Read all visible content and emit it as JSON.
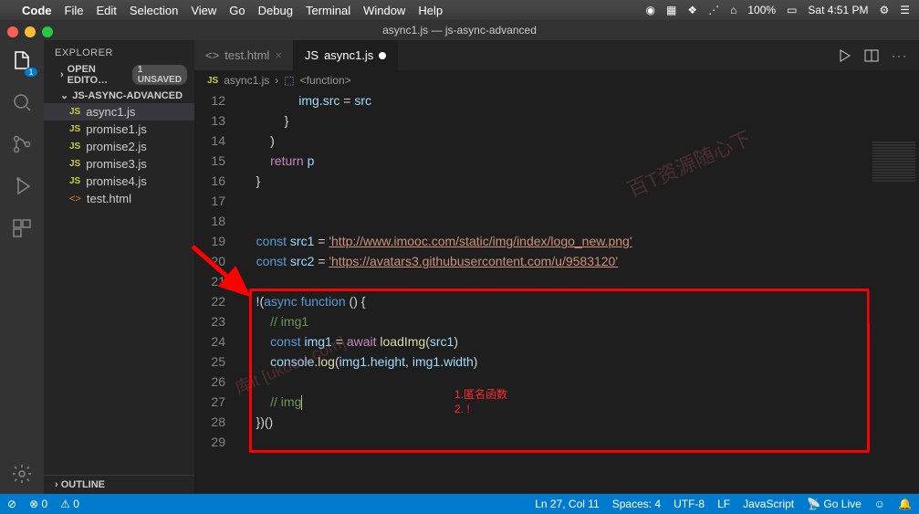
{
  "macmenu": {
    "app": "Code",
    "items": [
      "File",
      "Edit",
      "Selection",
      "View",
      "Go",
      "Debug",
      "Terminal",
      "Window",
      "Help"
    ],
    "battery": "100%",
    "time": "Sat 4:51 PM"
  },
  "window": {
    "title": "async1.js — js-async-advanced"
  },
  "sidebar": {
    "header": "EXPLORER",
    "openEditors": {
      "label": "OPEN EDITO…",
      "unsaved": "1 UNSAVED"
    },
    "folder": "JS-ASYNC-ADVANCED",
    "files": [
      {
        "icon": "JS",
        "name": "async1.js",
        "active": true
      },
      {
        "icon": "JS",
        "name": "promise1.js"
      },
      {
        "icon": "JS",
        "name": "promise2.js"
      },
      {
        "icon": "JS",
        "name": "promise3.js"
      },
      {
        "icon": "JS",
        "name": "promise4.js"
      },
      {
        "icon": "<>",
        "name": "test.html"
      }
    ],
    "outline": "OUTLINE"
  },
  "tabs": [
    {
      "icon": "<>",
      "label": "test.html",
      "active": false,
      "modified": false
    },
    {
      "icon": "JS",
      "label": "async1.js",
      "active": true,
      "modified": true
    }
  ],
  "breadcrumbs": [
    "JS async1.js",
    "<function>"
  ],
  "code": {
    "lines": [
      {
        "n": 12,
        "html": "                img.src = src",
        "seg": [
          [
            "                ",
            ""
          ],
          [
            "img",
            ".va"
          ],
          [
            ".",
            ""
          ],
          [
            "src",
            ".va"
          ],
          [
            " = ",
            ""
          ],
          [
            "src",
            ".va"
          ]
        ]
      },
      {
        "n": 13,
        "html": "            }",
        "seg": [
          [
            "            }",
            ""
          ]
        ]
      },
      {
        "n": 14,
        "html": "        )",
        "seg": [
          [
            "        )",
            ""
          ]
        ]
      },
      {
        "n": 15,
        "html": "        return p",
        "seg": [
          [
            "        ",
            ""
          ],
          [
            "return",
            ".pu"
          ],
          [
            " ",
            ""
          ],
          [
            "p",
            ".va"
          ]
        ]
      },
      {
        "n": 16,
        "html": "    }",
        "seg": [
          [
            "    }",
            ""
          ]
        ]
      },
      {
        "n": 17,
        "html": "",
        "seg": [
          [
            "",
            ""
          ]
        ]
      },
      {
        "n": 18,
        "html": "",
        "seg": [
          [
            "",
            ""
          ]
        ]
      },
      {
        "n": 19,
        "seg": [
          [
            "    ",
            ""
          ],
          [
            "const",
            ".kw"
          ],
          [
            " ",
            ""
          ],
          [
            "src1",
            ".va"
          ],
          [
            " = ",
            ""
          ],
          [
            "'http://www.imooc.com/static/img/index/logo_new.png'",
            ".str"
          ]
        ]
      },
      {
        "n": 20,
        "seg": [
          [
            "    ",
            ""
          ],
          [
            "const",
            ".kw"
          ],
          [
            " ",
            ""
          ],
          [
            "src2",
            ".va"
          ],
          [
            " = ",
            ""
          ],
          [
            "'https://avatars3.githubusercontent.com/u/9583120'",
            ".str"
          ]
        ]
      },
      {
        "n": 21,
        "seg": [
          [
            "",
            ""
          ]
        ]
      },
      {
        "n": 22,
        "seg": [
          [
            "    !(",
            ""
          ],
          [
            "async",
            ".kw"
          ],
          [
            " ",
            ""
          ],
          [
            "function",
            ".kw"
          ],
          [
            " () {",
            ""
          ]
        ]
      },
      {
        "n": 23,
        "seg": [
          [
            "        ",
            ""
          ],
          [
            "// img1",
            ".cm"
          ]
        ]
      },
      {
        "n": 24,
        "seg": [
          [
            "        ",
            ""
          ],
          [
            "const",
            ".kw"
          ],
          [
            " ",
            ""
          ],
          [
            "img1",
            ".va"
          ],
          [
            " = ",
            ""
          ],
          [
            "await",
            ".pu"
          ],
          [
            " ",
            ""
          ],
          [
            "loadImg",
            ".fn"
          ],
          [
            "(",
            ""
          ],
          [
            "src1",
            ".va"
          ],
          [
            ")",
            ""
          ]
        ]
      },
      {
        "n": 25,
        "seg": [
          [
            "        ",
            ""
          ],
          [
            "console",
            ".va"
          ],
          [
            ".",
            ""
          ],
          [
            "log",
            ".fn"
          ],
          [
            "(",
            ""
          ],
          [
            "img1",
            ".va"
          ],
          [
            ".",
            ""
          ],
          [
            "height",
            ".va"
          ],
          [
            ", ",
            ""
          ],
          [
            "img1",
            ".va"
          ],
          [
            ".",
            ""
          ],
          [
            "width",
            ".va"
          ],
          [
            ")",
            ""
          ]
        ]
      },
      {
        "n": 26,
        "seg": [
          [
            "",
            ""
          ]
        ]
      },
      {
        "n": 27,
        "seg": [
          [
            "        ",
            ""
          ],
          [
            "// img",
            ".cm"
          ]
        ],
        "cursor": true
      },
      {
        "n": 28,
        "seg": [
          [
            "    })()",
            ""
          ]
        ]
      },
      {
        "n": 29,
        "seg": [
          [
            "",
            ""
          ]
        ]
      }
    ]
  },
  "annotations": {
    "line1": "1.匿名函数",
    "line2": "2. !"
  },
  "status": {
    "errors": "0",
    "warnings": "0",
    "lncol": "Ln 27, Col 11",
    "spaces": "Spaces: 4",
    "encoding": "UTF-8",
    "eol": "LF",
    "lang": "JavaScript",
    "golive": "Go Live",
    "smile": "☺"
  },
  "activity_badge": "1"
}
